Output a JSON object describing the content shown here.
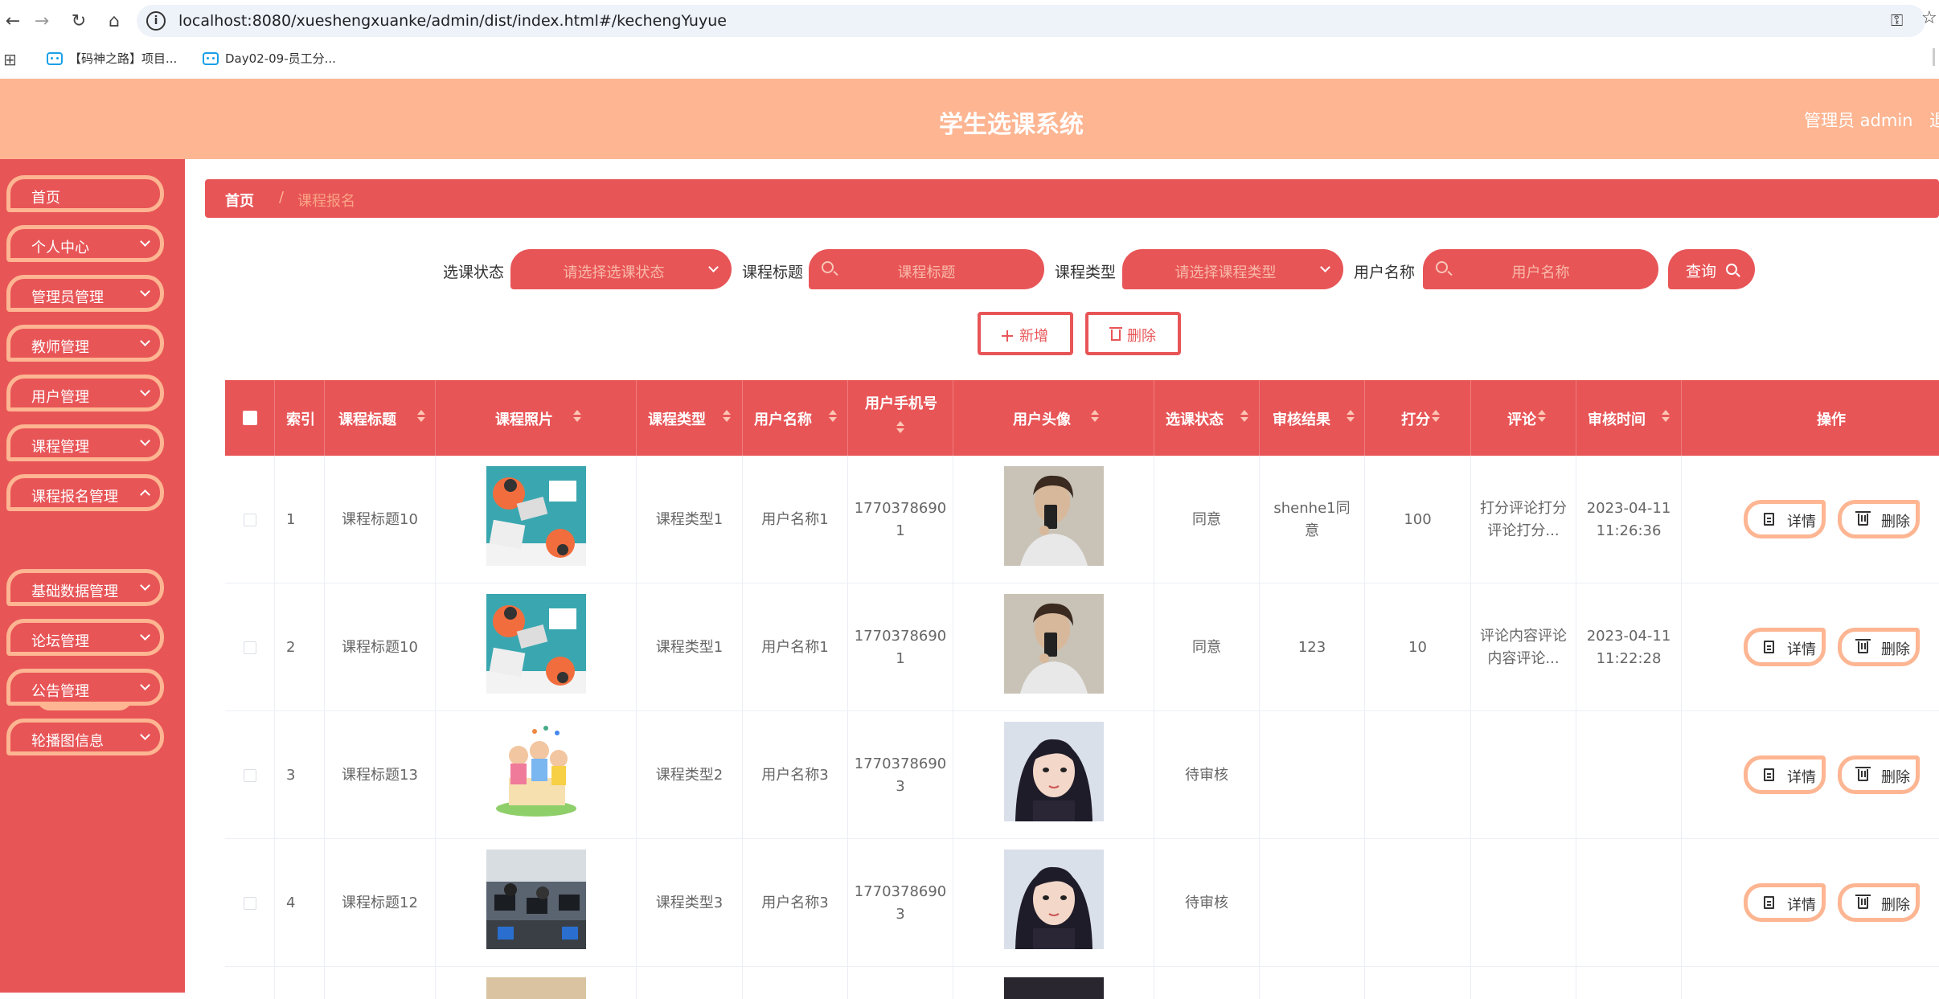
{
  "browser": {
    "url": "localhost:8080/xueshengxuanke/admin/dist/index.html#/kechengYuyue",
    "bookmarks": [
      "【码神之路】项目...",
      "Day02-09-员工分..."
    ]
  },
  "header": {
    "title": "学生选课系统",
    "admin_label": "管理员 admin",
    "logout_label": "退"
  },
  "sidebar": {
    "items": [
      {
        "label": "首页"
      },
      {
        "label": "个人中心"
      },
      {
        "label": "管理员管理"
      },
      {
        "label": "教师管理"
      },
      {
        "label": "用户管理"
      },
      {
        "label": "课程管理"
      },
      {
        "label": "课程报名管理"
      },
      {
        "label": "基础数据管理"
      },
      {
        "label": "论坛管理"
      },
      {
        "label": "公告管理"
      },
      {
        "label": "轮播图信息"
      }
    ],
    "active_sub": "课程报名管理"
  },
  "breadcrumb": {
    "home": "首页",
    "sep": "/",
    "current": "课程报名"
  },
  "filters": {
    "status_label": "选课状态",
    "status_placeholder": "请选择选课状态",
    "title_label": "课程标题",
    "title_placeholder": "课程标题",
    "type_label": "课程类型",
    "type_placeholder": "请选择课程类型",
    "user_label": "用户名称",
    "user_placeholder": "用户名称",
    "query_label": "查询"
  },
  "actions": {
    "add_label": "新增",
    "delete_label": "删除"
  },
  "table": {
    "headers": {
      "index": "索引",
      "title": "课程标题",
      "photo": "课程照片",
      "type": "课程类型",
      "user": "用户名称",
      "phone": "用户手机号",
      "avatar": "用户头像",
      "status": "选课状态",
      "result": "审核结果",
      "score": "打分",
      "comment": "评论",
      "time": "审核时间",
      "ops": "操作"
    },
    "rows": [
      {
        "index": "1",
        "title": "课程标题10",
        "type": "课程类型1",
        "user": "用户名称1",
        "phone1": "1770378690",
        "phone2": "1",
        "status": "同意",
        "result1": "shenhe1同",
        "result2": "意",
        "score": "100",
        "comment1": "打分评论打分",
        "comment2": "评论打分...",
        "time1": "2023-04-11",
        "time2": "11:26:36",
        "detail": "详情",
        "delete": "删除"
      },
      {
        "index": "2",
        "title": "课程标题10",
        "type": "课程类型1",
        "user": "用户名称1",
        "phone1": "1770378690",
        "phone2": "1",
        "status": "同意",
        "result1": "123",
        "result2": "",
        "score": "10",
        "comment1": "评论内容评论",
        "comment2": "内容评论...",
        "time1": "2023-04-11",
        "time2": "11:22:28",
        "detail": "详情",
        "delete": "删除"
      },
      {
        "index": "3",
        "title": "课程标题13",
        "type": "课程类型2",
        "user": "用户名称3",
        "phone1": "1770378690",
        "phone2": "3",
        "status": "待审核",
        "result1": "",
        "result2": "",
        "score": "",
        "comment1": "",
        "comment2": "",
        "time1": "",
        "time2": "",
        "detail": "详情",
        "delete": "删除"
      },
      {
        "index": "4",
        "title": "课程标题12",
        "type": "课程类型3",
        "user": "用户名称3",
        "phone1": "1770378690",
        "phone2": "3",
        "status": "待审核",
        "result1": "",
        "result2": "",
        "score": "",
        "comment1": "",
        "comment2": "",
        "time1": "",
        "time2": "",
        "detail": "详情",
        "delete": "删除"
      }
    ]
  },
  "colors": {
    "primary": "#e85557",
    "accent": "#fdb592"
  }
}
